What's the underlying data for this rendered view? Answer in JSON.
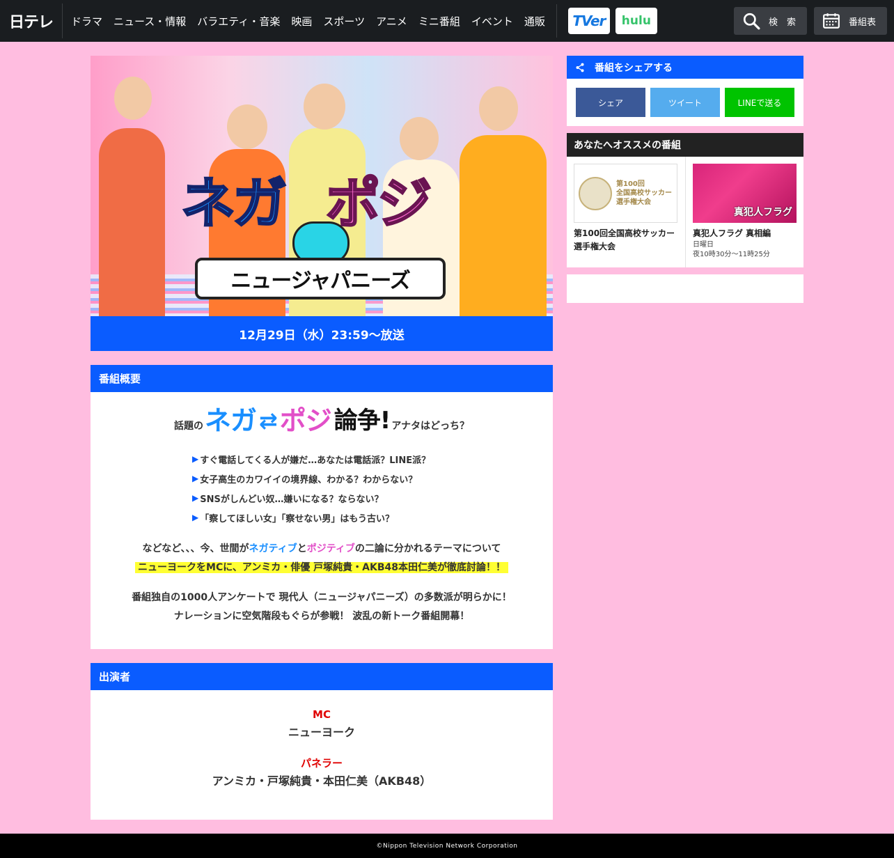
{
  "header": {
    "logo": "日テレ",
    "nav": [
      "ドラマ",
      "ニュース・情報",
      "バラエティ・音楽",
      "映画",
      "スポーツ",
      "アニメ",
      "ミニ番組",
      "イベント",
      "通販"
    ],
    "tver": "TVer",
    "hulu": "hulu",
    "search_label": "検　索",
    "schedule_label": "番組表",
    "icons": {
      "search": "search-icon",
      "schedule": "calendar-icon"
    }
  },
  "hero": {
    "title_nega": "ネガ",
    "title_posi": "ポジ",
    "subtitle": "ニュージャパニーズ",
    "airtime": "12月29日（水）23:59～放送"
  },
  "summary": {
    "heading": "番組概要",
    "lead_pre": "話題の",
    "lead_nega": "ネガ",
    "lead_arrow": "⇄",
    "lead_posi": "ポジ",
    "lead_ronso": "論争!",
    "lead_post": "アナタはどっち？",
    "bullets": [
      "すぐ電話してくる人が嫌だ…あなたは電話派？LINE派？",
      "女子高生のカワイイの境界線、わかる？わからない？",
      "SNSがしんどい奴…嫌いになる？ならない？",
      "「察してほしい女」「察せない男」はもう古い？"
    ],
    "p1_a": "などなど、、、今、世間が",
    "p1_nega": "ネガティブ",
    "p1_to": "と",
    "p1_posi": "ポジティブ",
    "p1_b": "の二論に分かれるテーマについて",
    "p1_highlight": "ニューヨークをMCに、アンミカ・俳優 戸塚純貴・AKB48本田仁美が徹底討論！！",
    "p2_line1": "番組独自の1000人アンケートで 現代人（ニュージャパニーズ）の多数派が明らかに！",
    "p2_line2": "ナレーションに空気階段もぐらが参戦！ 波乱の新トーク番組開幕！"
  },
  "cast": {
    "heading": "出演者",
    "groups": [
      {
        "role": "MC",
        "names": "ニューヨーク"
      },
      {
        "role": "パネラー",
        "names": "アンミカ・戸塚純貴・本田仁美（AKB48）"
      }
    ]
  },
  "share": {
    "heading": "番組をシェアする",
    "facebook": "シェア",
    "twitter": "ツイート",
    "line": "LINEで送る",
    "colors": {
      "facebook": "#3b5998",
      "twitter": "#55acee",
      "line": "#00c300"
    }
  },
  "recommend": {
    "heading": "あなたへオススメの番組",
    "items": [
      {
        "thumb_text": "第100回\n全国高校サッカー\n選手権大会",
        "title": "第100回全国高校サッカー選手権大会",
        "day": "",
        "time": ""
      },
      {
        "thumb_text": "真犯人フラグ",
        "title": "真犯人フラグ 真相編",
        "day": "日曜日",
        "time": "夜10時30分～11時25分"
      }
    ]
  },
  "footer": {
    "copyright": "©Nippon Television Network Corporation"
  },
  "colors": {
    "accent_blue": "#0a5cff",
    "background_pink": "#ffbde0",
    "role_red": "#e00000",
    "highlight": "#ffff33"
  }
}
